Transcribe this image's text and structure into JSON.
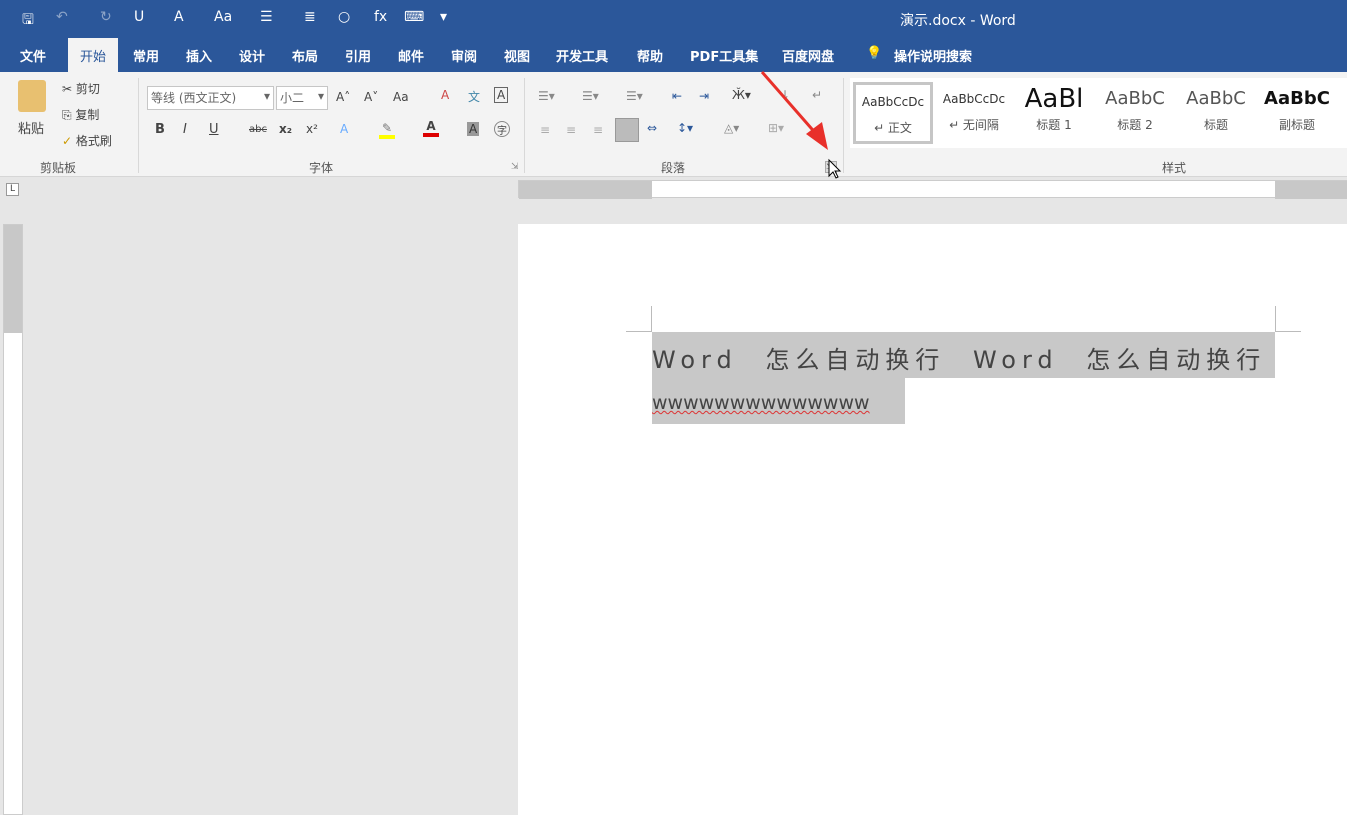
{
  "window": {
    "title": "演示.docx  -  Word"
  },
  "quick_access": [
    {
      "icon": "save-icon",
      "glyph": "🖫"
    },
    {
      "icon": "undo-icon",
      "glyph": "↶"
    },
    {
      "icon": "redo-icon",
      "glyph": "↻"
    },
    {
      "icon": "underline-icon",
      "glyph": "U"
    },
    {
      "icon": "text-effect-icon",
      "glyph": "A"
    },
    {
      "icon": "change-case-icon",
      "glyph": "Aa"
    },
    {
      "icon": "bullets-icon",
      "glyph": "☰"
    },
    {
      "icon": "align-icon",
      "glyph": "≣"
    },
    {
      "icon": "shape-icon",
      "glyph": "○"
    },
    {
      "icon": "formula-icon",
      "glyph": "fx"
    },
    {
      "icon": "comment-icon",
      "glyph": "⌨"
    },
    {
      "icon": "customize-icon",
      "glyph": "▾"
    }
  ],
  "tabs": [
    "文件",
    "开始",
    "常用",
    "插入",
    "设计",
    "布局",
    "引用",
    "邮件",
    "审阅",
    "视图",
    "开发工具",
    "帮助",
    "PDF工具集",
    "百度网盘",
    "操作说明搜索"
  ],
  "active_tab": "开始",
  "clipboard": {
    "paste": "粘贴",
    "cut": "剪切",
    "copy": "复制",
    "format_painter": "格式刷",
    "group": "剪贴板"
  },
  "font": {
    "name": "等线 (西文正文)",
    "size": "小二",
    "group": "字体",
    "bold": "B",
    "italic": "I",
    "underline": "U",
    "strike": "abc",
    "sub": "x₂",
    "sup": "x²",
    "grow": "A˄",
    "shrink": "A˅",
    "case": "Aa",
    "highlight_color": "#ffff00",
    "font_color": "#d00000"
  },
  "paragraph": {
    "group": "段落"
  },
  "styles": {
    "group": "样式",
    "items": [
      {
        "preview": "AaBbCcDc",
        "label": "↵ 正文"
      },
      {
        "preview": "AaBbCcDc",
        "label": "↵ 无间隔"
      },
      {
        "preview": "AaBl",
        "label": "标题 1"
      },
      {
        "preview": "AaBbC",
        "label": "标题 2"
      },
      {
        "preview": "AaBbC",
        "label": "标题"
      },
      {
        "preview": "AaBbC",
        "label": "副标题"
      }
    ]
  },
  "document": {
    "line1": "Word 怎么自动换行 Word 怎么自动换行",
    "line2": "wwwwwwwwwwwwww"
  },
  "colors": {
    "brand": "#2b579a",
    "annotation_arrow": "#e8302a",
    "selection": "#c8c8c8"
  }
}
